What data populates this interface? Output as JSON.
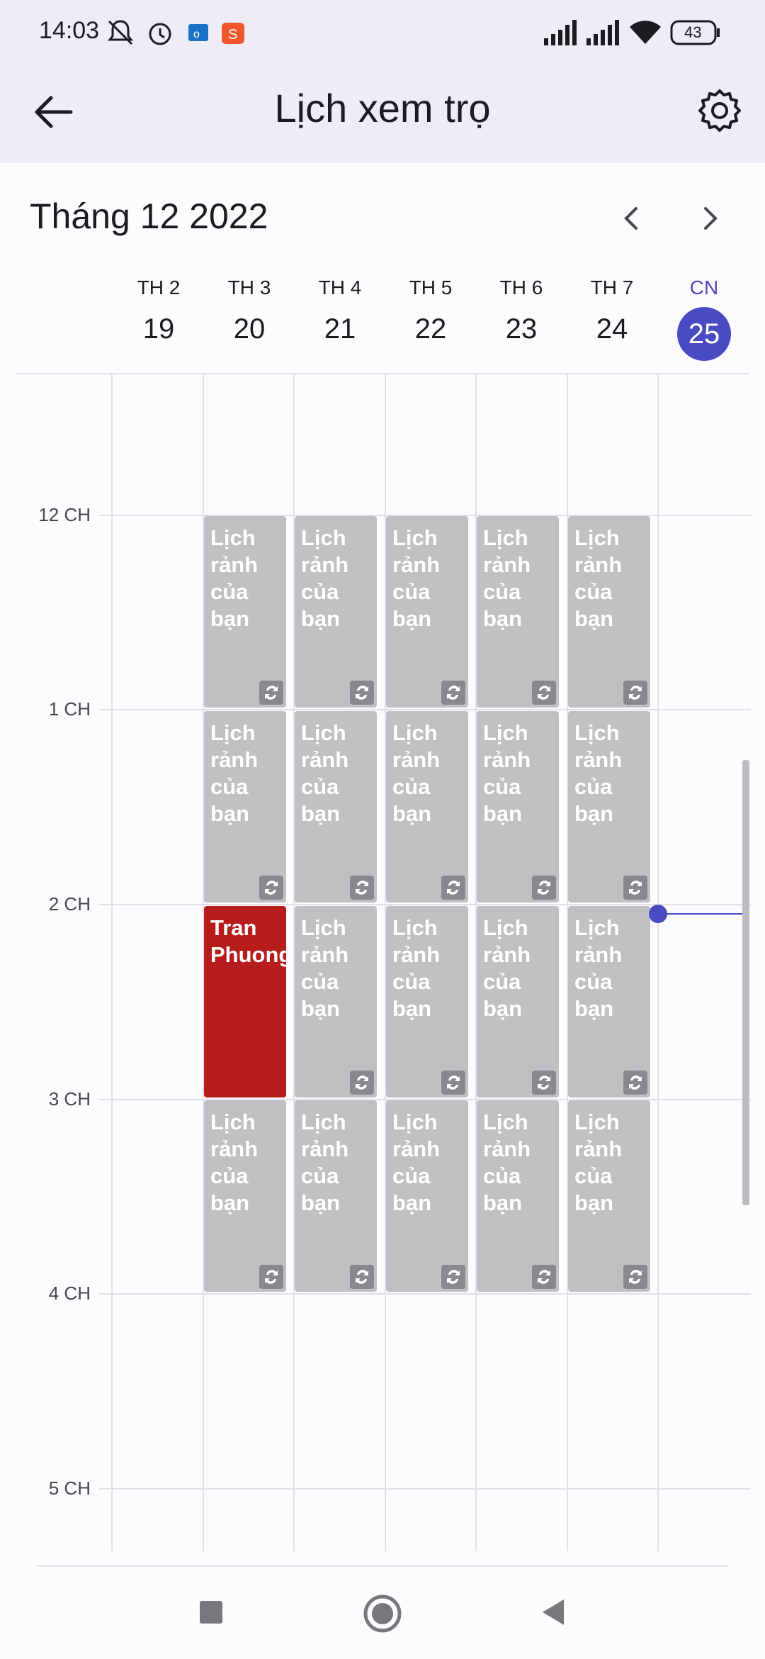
{
  "status_bar": {
    "time": "14:03",
    "battery": "43",
    "icons": [
      "mute-icon",
      "alarm-icon",
      "outlook-icon",
      "shopee-icon",
      "signal-icon",
      "signal-icon",
      "wifi-icon",
      "battery-icon"
    ]
  },
  "app_bar": {
    "title": "Lịch xem trọ",
    "back_icon": "arrow-left-icon",
    "settings_icon": "gear-icon"
  },
  "calendar": {
    "month_label": "Tháng 12 2022",
    "days": [
      {
        "name": "TH 2",
        "date": "19"
      },
      {
        "name": "TH 3",
        "date": "20"
      },
      {
        "name": "TH 4",
        "date": "21"
      },
      {
        "name": "TH 5",
        "date": "22"
      },
      {
        "name": "TH 6",
        "date": "23"
      },
      {
        "name": "TH 7",
        "date": "24"
      },
      {
        "name": "CN",
        "date": "25"
      }
    ],
    "hours": [
      "12 CH",
      "1 CH",
      "2 CH",
      "3 CH",
      "4 CH",
      "5 CH"
    ],
    "free_slot_label": "Lịch rảnh của bạn",
    "booked_label": "Tran Phuong",
    "colors": {
      "accent": "#4a4ac2",
      "free_slot": "#c2bfc3",
      "booked": "#b71c1c"
    }
  },
  "nav_bar": {
    "icons": [
      "square-recents-icon",
      "circle-home-icon",
      "triangle-back-icon"
    ]
  }
}
